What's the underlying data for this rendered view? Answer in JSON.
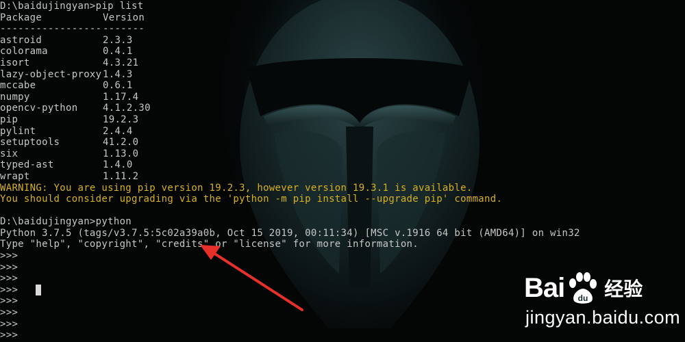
{
  "terminal": {
    "prompt1": "D:\\baidujingyan>pip list",
    "header": {
      "package": "Package",
      "version": "Version"
    },
    "separator": {
      "package": "-----------------",
      "version": "-------"
    },
    "packages": [
      {
        "name": "astroid",
        "version": "2.3.3"
      },
      {
        "name": "colorama",
        "version": "0.4.1"
      },
      {
        "name": "isort",
        "version": "4.3.21"
      },
      {
        "name": "lazy-object-proxy",
        "version": "1.4.3"
      },
      {
        "name": "mccabe",
        "version": "0.6.1"
      },
      {
        "name": "numpy",
        "version": "1.17.4"
      },
      {
        "name": "opencv-python",
        "version": "4.1.2.30"
      },
      {
        "name": "pip",
        "version": "19.2.3"
      },
      {
        "name": "pylint",
        "version": "2.4.4"
      },
      {
        "name": "setuptools",
        "version": "41.2.0"
      },
      {
        "name": "six",
        "version": "1.13.0"
      },
      {
        "name": "typed-ast",
        "version": "1.4.0"
      },
      {
        "name": "wrapt",
        "version": "1.11.2"
      }
    ],
    "warning1": "WARNING: You are using pip version 19.2.3, however version 19.3.1 is available.",
    "warning2": "You should consider upgrading via the 'python -m pip install --upgrade pip' command.",
    "prompt2": "D:\\baidujingyan>python",
    "python_version": "Python 3.7.5 (tags/v3.7.5:5c02a39a0b, Oct 15 2019, 00:11:34) [MSC v.1916 64 bit (AMD64)] on win32",
    "python_help": "Type \"help\", \"copyright\", \"credits\" or \"license\" for more information.",
    "repl_prompts": [
      ">>>",
      ">>>",
      ">>>",
      ">>>",
      ">>>",
      ">>>",
      ">>>",
      ">>>"
    ]
  },
  "colors": {
    "text": "#c7c7c7",
    "warning": "#d8b21c",
    "background": "#040606",
    "arrow": "#e8302a"
  },
  "watermark": {
    "brand": "Bai",
    "brand_suffix": "经验",
    "url": "jingyan.baidu.com"
  }
}
